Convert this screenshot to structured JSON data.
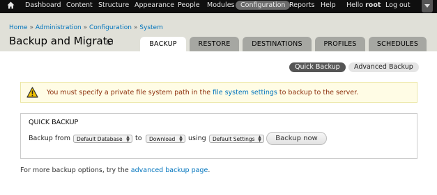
{
  "toolbar": {
    "items": [
      "Dashboard",
      "Content",
      "Structure",
      "Appearance",
      "People",
      "Modules",
      "Configuration",
      "Reports",
      "Help"
    ],
    "active": "Configuration",
    "hello_prefix": "Hello",
    "username": "root",
    "logout": "Log out"
  },
  "breadcrumb": {
    "home": "Home",
    "sep": "»",
    "administration": "Administration",
    "configuration": "Configuration",
    "system": "System"
  },
  "page_title": "Backup and Migrate",
  "tabs": [
    {
      "label": "BACKUP",
      "active": true
    },
    {
      "label": "RESTORE",
      "active": false
    },
    {
      "label": "DESTINATIONS",
      "active": false
    },
    {
      "label": "PROFILES",
      "active": false
    },
    {
      "label": "SCHEDULES",
      "active": false
    }
  ],
  "actions": {
    "quick_backup": "Quick Backup",
    "advanced_backup": "Advanced Backup"
  },
  "warning": {
    "text_before": "You must specify a private file system path in the",
    "link": "file system settings",
    "text_after": "to backup to the server."
  },
  "quick_backup": {
    "legend": "QUICK BACKUP",
    "backup_from_label": "Backup from",
    "source_value": "Default Database",
    "to_label": "to",
    "destination_value": "Download",
    "using_label": "using",
    "profile_value": "Default Settings",
    "submit_label": "Backup now"
  },
  "footer": {
    "text_before": "For more backup options, try the",
    "link": "advanced backup page",
    "text_after": "."
  },
  "colors": {
    "toolbar_bg": "#0f0f0f",
    "header_bg": "#e0e0d8",
    "link": "#0074bd",
    "warning_bg": "#fffce5",
    "warning_text": "#8c2e0b",
    "tab_inactive": "#a6a7a2"
  }
}
